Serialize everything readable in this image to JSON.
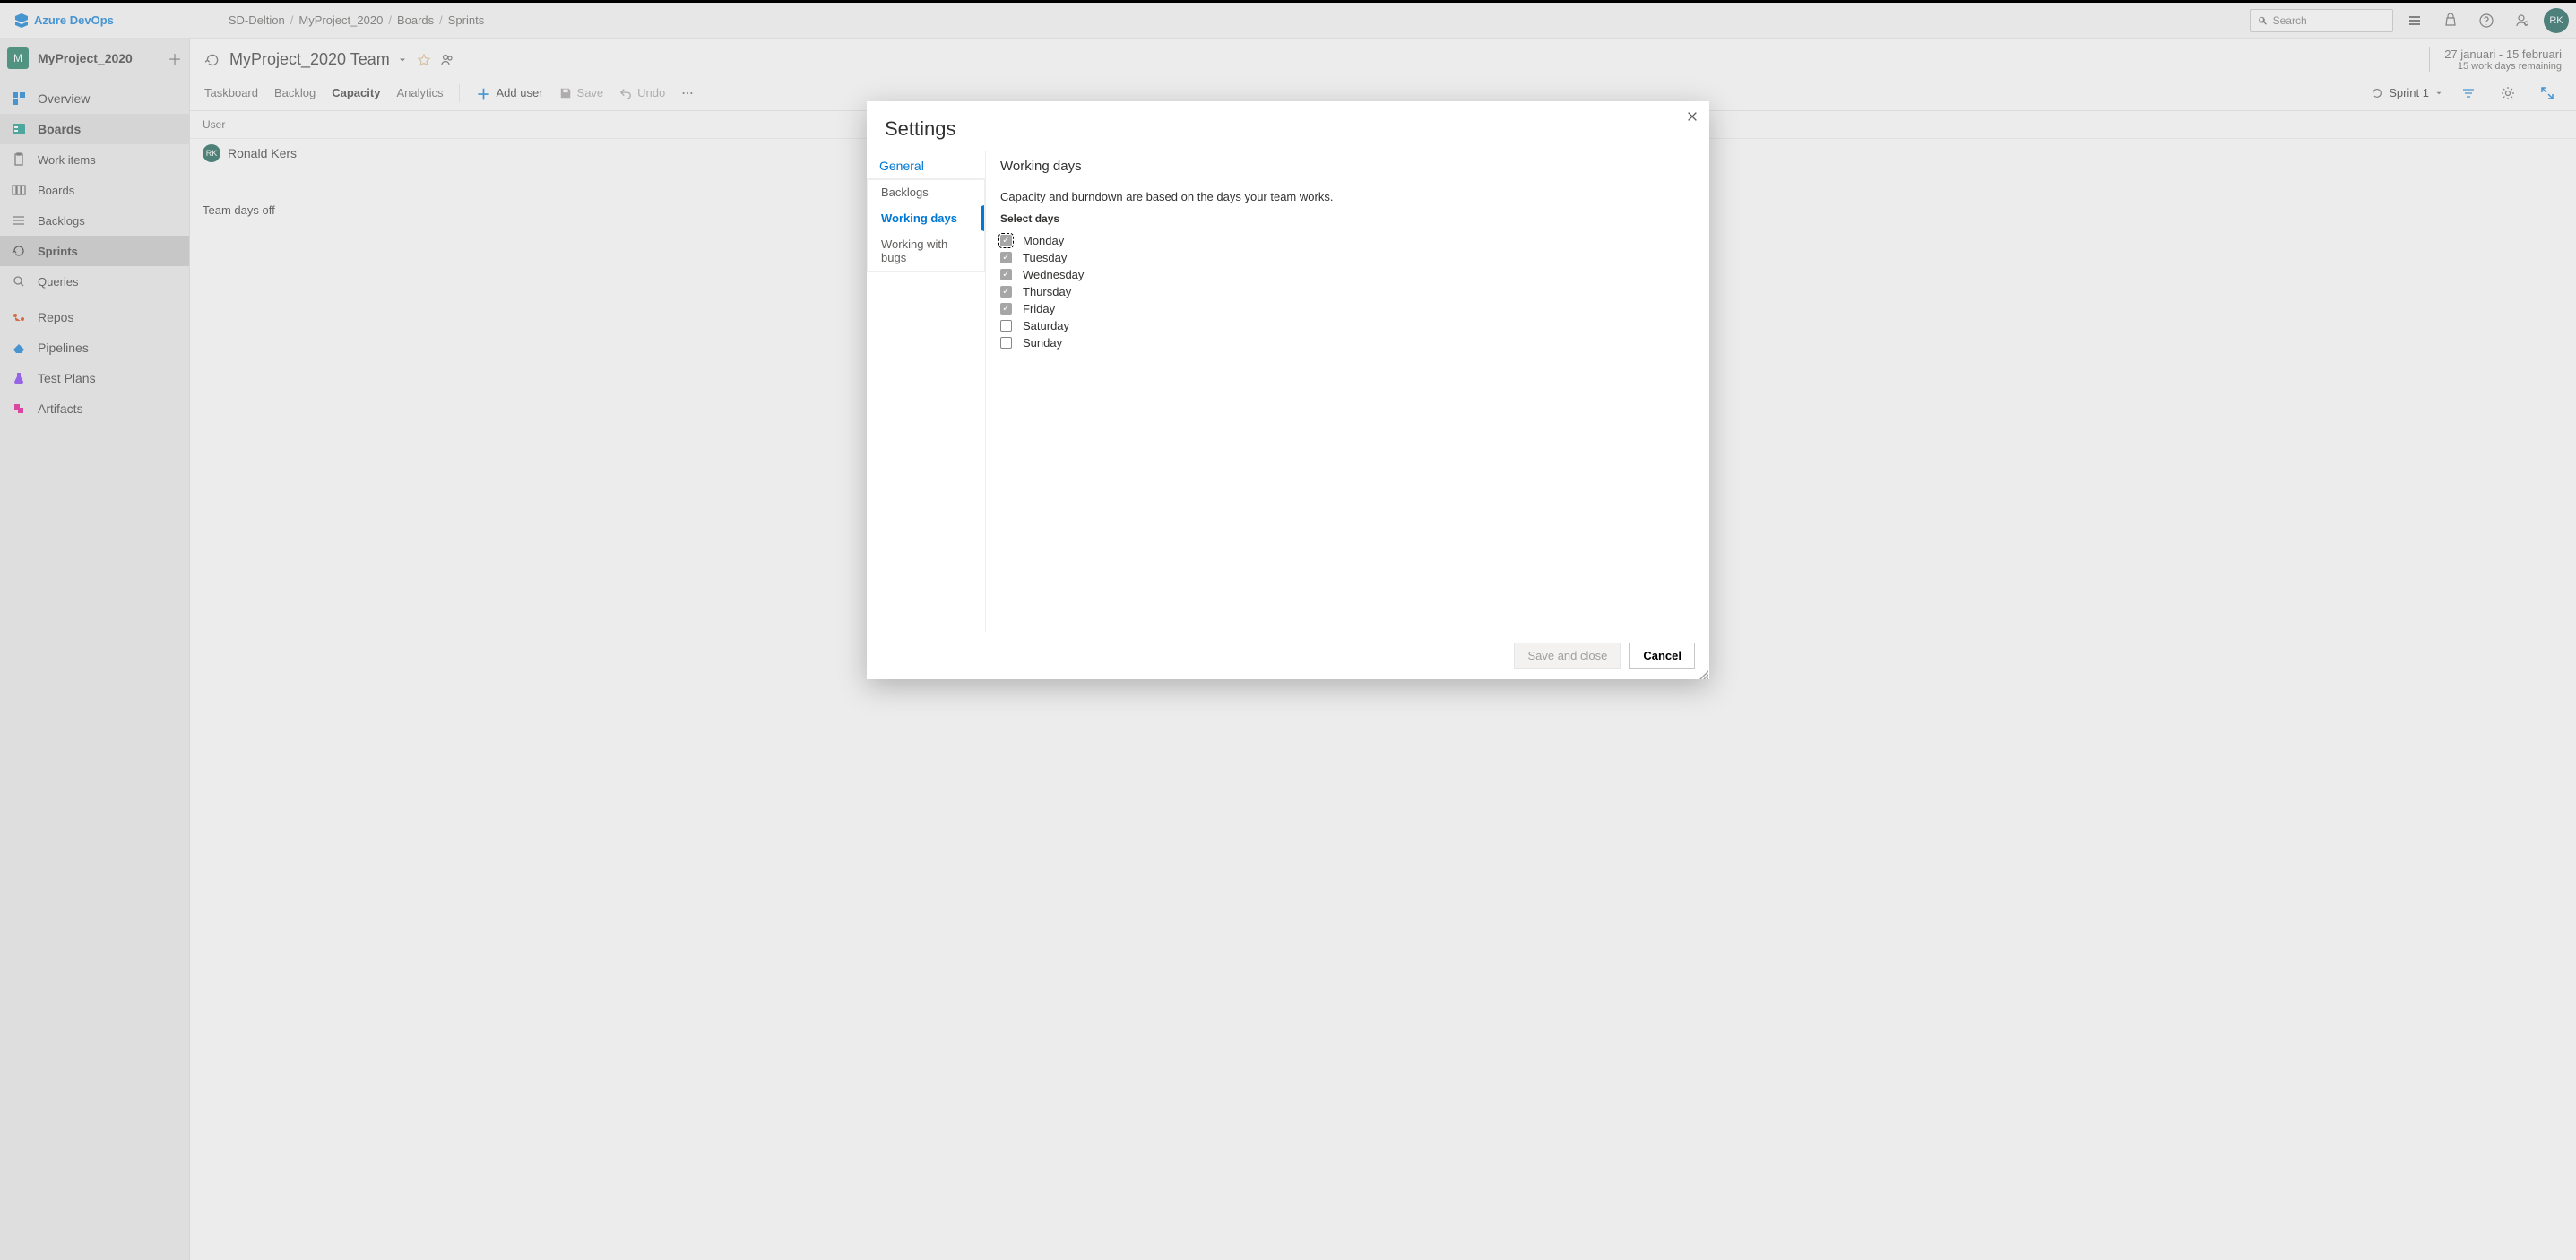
{
  "topbar": {
    "brand": "Azure DevOps",
    "breadcrumbs": [
      "SD-Deltion",
      "MyProject_2020",
      "Boards",
      "Sprints"
    ],
    "search_placeholder": "Search",
    "avatar_initials": "RK"
  },
  "sidebar": {
    "project_initial": "M",
    "project_name": "MyProject_2020",
    "primary": [
      {
        "label": "Overview",
        "key": "overview"
      },
      {
        "label": "Boards",
        "key": "boards",
        "active": true
      }
    ],
    "boards_sub": [
      {
        "label": "Work items"
      },
      {
        "label": "Boards"
      },
      {
        "label": "Backlogs"
      },
      {
        "label": "Sprints",
        "active": true
      },
      {
        "label": "Queries"
      }
    ],
    "secondary": [
      {
        "label": "Repos",
        "key": "repos"
      },
      {
        "label": "Pipelines",
        "key": "pipelines"
      },
      {
        "label": "Test Plans",
        "key": "testplans"
      },
      {
        "label": "Artifacts",
        "key": "artifacts"
      }
    ]
  },
  "main": {
    "team_name": "MyProject_2020 Team",
    "date_range": "27 januari - 15 februari",
    "remaining": "15 work days remaining",
    "tabs": [
      "Taskboard",
      "Backlog",
      "Capacity",
      "Analytics"
    ],
    "active_tab_index": 2,
    "add_user_label": "Add user",
    "save_label": "Save",
    "undo_label": "Undo",
    "sprint_label": "Sprint 1",
    "user_header": "User",
    "users": [
      {
        "initials": "RK",
        "name": "Ronald Kers"
      }
    ],
    "team_off_label": "Team days off"
  },
  "dialog": {
    "title": "Settings",
    "nav_header": "General",
    "nav_items": [
      {
        "label": "Backlogs"
      },
      {
        "label": "Working days",
        "active": true
      },
      {
        "label": "Working with bugs"
      }
    ],
    "panel_title": "Working days",
    "panel_desc": "Capacity and burndown are based on the days your team works.",
    "select_days_label": "Select days",
    "days": [
      {
        "label": "Monday",
        "checked": true,
        "focus": true
      },
      {
        "label": "Tuesday",
        "checked": true
      },
      {
        "label": "Wednesday",
        "checked": true
      },
      {
        "label": "Thursday",
        "checked": true
      },
      {
        "label": "Friday",
        "checked": true
      },
      {
        "label": "Saturday",
        "checked": false
      },
      {
        "label": "Sunday",
        "checked": false
      }
    ],
    "save_and_close": "Save and close",
    "cancel": "Cancel"
  }
}
